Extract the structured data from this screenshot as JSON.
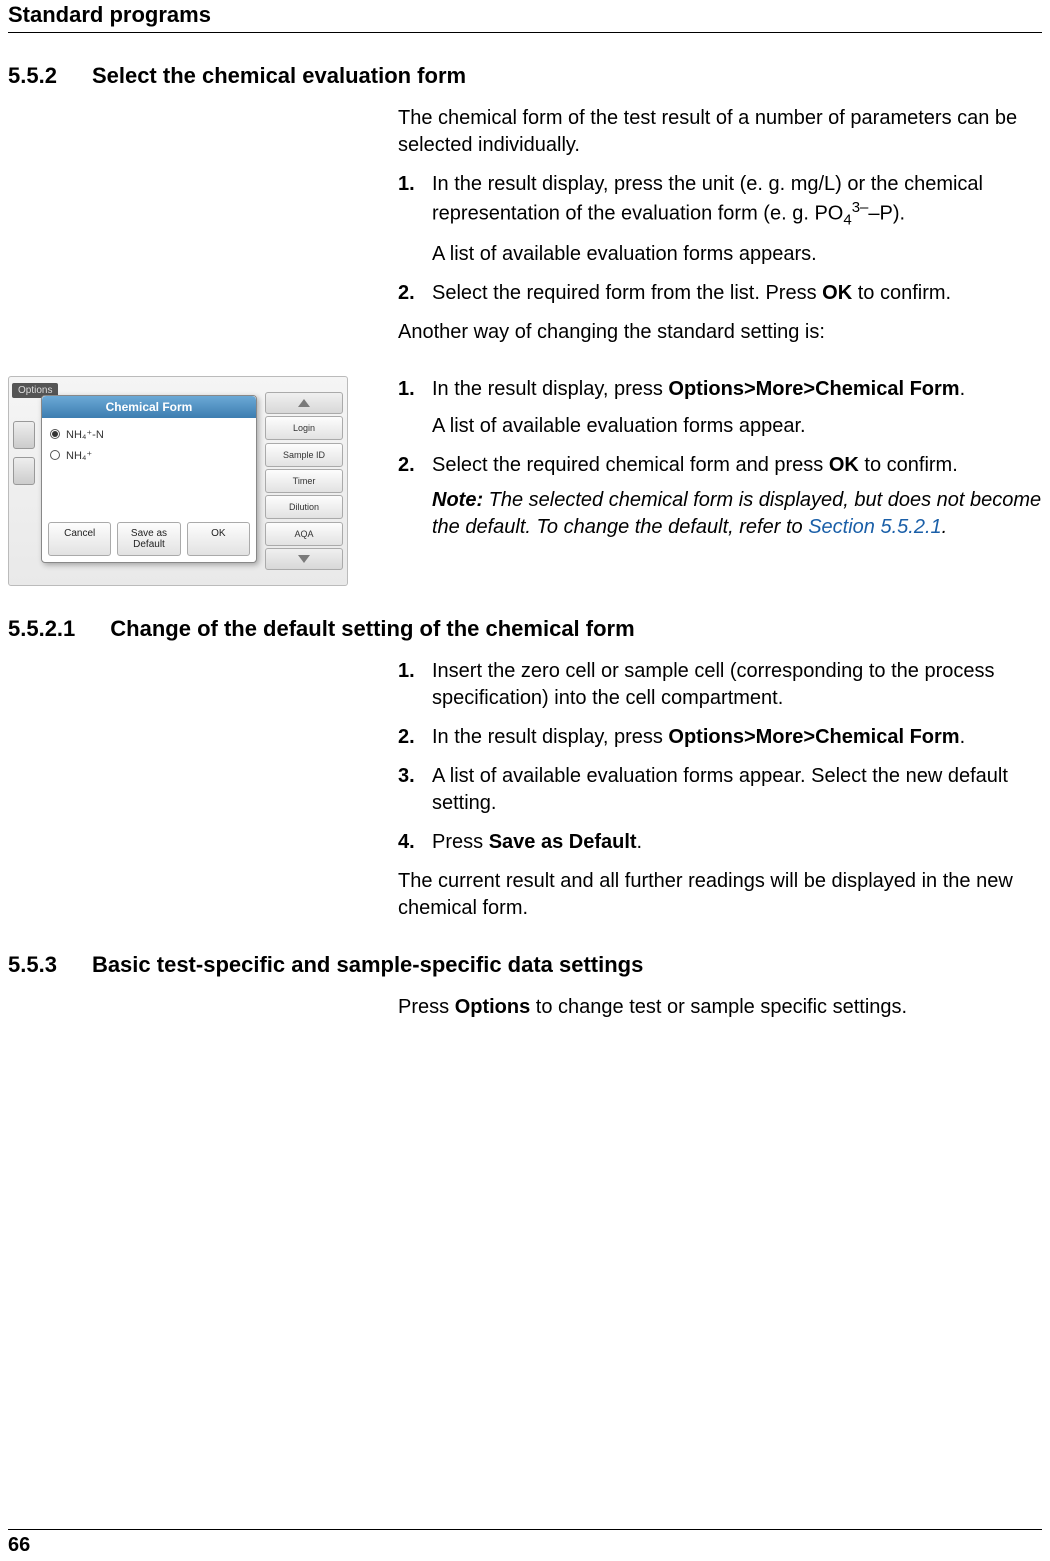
{
  "header": {
    "chapter_title": "Standard programs"
  },
  "section_552": {
    "number": "5.5.2",
    "title": "Select the chemical evaluation form",
    "intro": "The chemical form of the test result of a number of parameters can be selected individually.",
    "step1_num": "1.",
    "step1_text_a": "In the result display, press the unit (e. g. mg/L) or the chemical representation of the evaluation form (e. g. PO",
    "step1_sub4": "4",
    "step1_sup3": "3–",
    "step1_text_b": "–P).",
    "step1_sub": "A list of available evaluation forms appears.",
    "step2_num": "2.",
    "step2_text_a": "Select the required form from the list. Press ",
    "step2_bold": "OK",
    "step2_text_b": " to confirm.",
    "alt_intro": "Another way of changing the standard setting is:"
  },
  "screenshot": {
    "options_label": "Options",
    "dialog_title": "Chemical Form",
    "radio1": "NH₄⁺-N",
    "radio2": "NH₄⁺",
    "btn_cancel": "Cancel",
    "btn_default": "Save as Default",
    "btn_ok": "OK",
    "side_login": "Login",
    "side_sampleid": "Sample ID",
    "side_timer": "Timer",
    "side_dilution": "Dilution",
    "side_aqa": "AQA"
  },
  "block2": {
    "step1_num": "1.",
    "step1_text_a": "In the result display, press ",
    "step1_bold": "Options>More>Chemical Form",
    "step1_text_b": ".",
    "step1_sub": "A list of available evaluation forms appear.",
    "step2_num": "2.",
    "step2_text_a": "Select the required chemical form and press ",
    "step2_bold": "OK",
    "step2_text_b": " to confirm.",
    "note_label": "Note:",
    "note_text_a": " The selected chemical form is displayed, but does not become the default. To change the default, refer to ",
    "note_link": "Section 5.5.2.1",
    "note_text_b": "."
  },
  "section_5521": {
    "number": "5.5.2.1",
    "title": "Change of the default setting of the chemical form",
    "step1_num": "1.",
    "step1_text": "Insert the zero cell or sample cell (corresponding to the process specification) into the cell compartment.",
    "step2_num": "2.",
    "step2_text_a": "In the result display, press ",
    "step2_bold": "Options>More>Chemical Form",
    "step2_text_b": ".",
    "step3_num": "3.",
    "step3_text": "A list of available evaluation forms appear. Select the new default setting.",
    "step4_num": "4.",
    "step4_text_a": "Press ",
    "step4_bold": "Save as Default",
    "step4_text_b": ".",
    "outro": "The current result and all further readings will be displayed in the new chemical form."
  },
  "section_553": {
    "number": "5.5.3",
    "title": "Basic test-specific and sample-specific data settings",
    "text_a": "Press ",
    "text_bold": "Options",
    "text_b": " to change test or sample specific settings."
  },
  "footer": {
    "page_number": "66"
  }
}
